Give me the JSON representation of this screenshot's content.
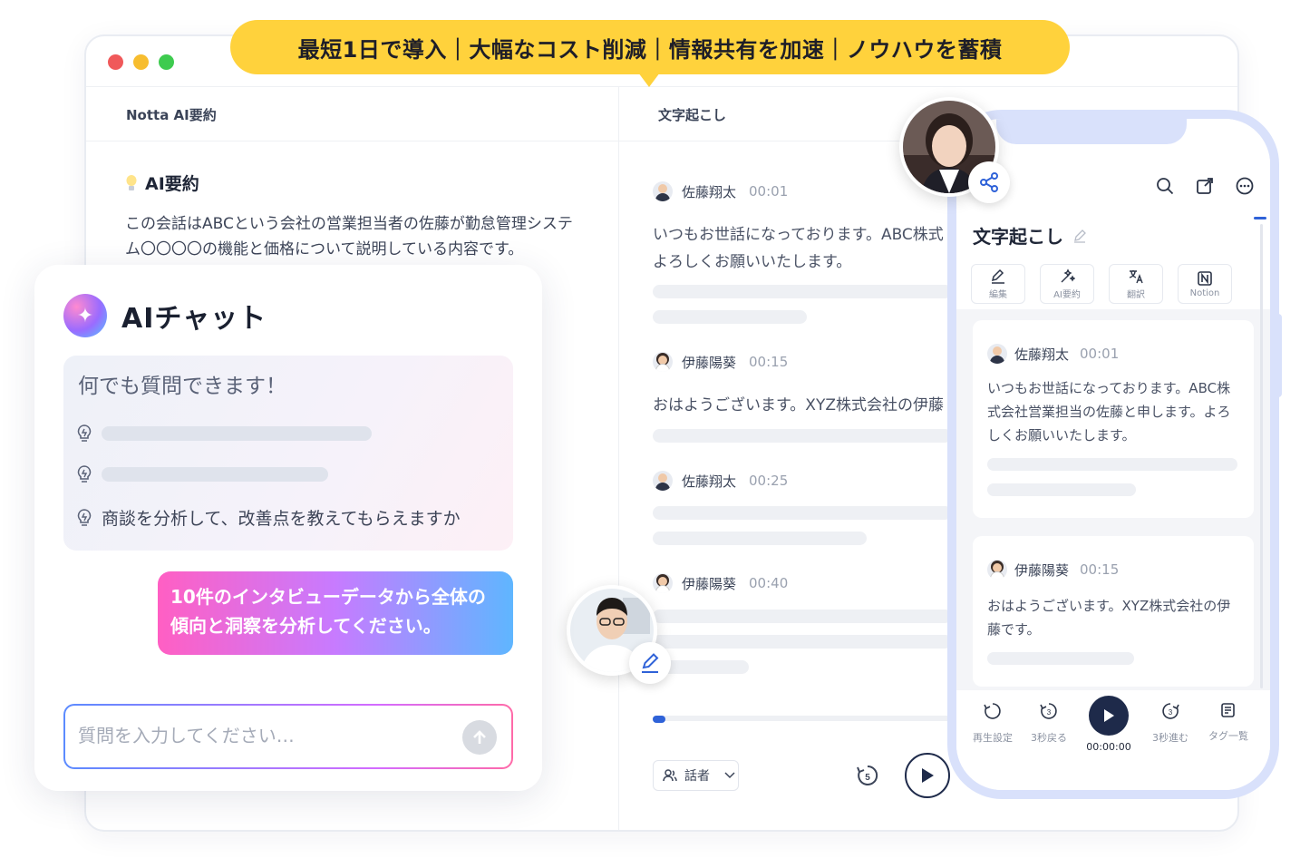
{
  "banner": {
    "text": "最短1日で導入｜大幅なコスト削減｜情報共有を加速｜ノウハウを蓄積"
  },
  "window": {
    "dot_colors": [
      "#f0595a",
      "#f7bd2f",
      "#3ecb4f"
    ],
    "left_panel_title": "Notta AI要約",
    "right_panel_title": "文字起こし"
  },
  "summary": {
    "title": "AI要約",
    "text": "この会話はABCという会社の営業担当者の佐藤が勤怠管理システム〇〇〇〇の機能と価格について説明している内容です。"
  },
  "chat": {
    "title": "AIチャット",
    "suggest_head": "何でも質問できます！",
    "suggestion_3": "商談を分析して、改善点を教えてもらえますか",
    "user_message": "10件のインタビューデータから全体の傾向と洞察を分析してください。",
    "input_placeholder": "質問を入力してください…"
  },
  "transcript": {
    "entries": [
      {
        "speaker": "佐藤翔太",
        "time": "00:01",
        "text1": "いつもお世話になっております。ABC株式",
        "text2": "よろしくお願いいたします。"
      },
      {
        "speaker": "伊藤陽葵",
        "time": "00:15",
        "text1": "おはようございます。XYZ株式会社の伊藤"
      },
      {
        "speaker": "佐藤翔太",
        "time": "00:25"
      },
      {
        "speaker": "伊藤陽葵",
        "time": "00:40"
      }
    ],
    "speaker_filter": "話者",
    "rewind_seconds": "5"
  },
  "phone": {
    "title": "文字起こし",
    "tools": [
      {
        "icon": "edit-icon",
        "label": "編集"
      },
      {
        "icon": "ai-sparkle-icon",
        "label": "AI要約"
      },
      {
        "icon": "translate-icon",
        "label": "翻訳"
      },
      {
        "icon": "notion-icon",
        "label": "Notion"
      }
    ],
    "card1": {
      "speaker": "佐藤翔太",
      "time": "00:01",
      "text": "いつもお世話になっております。ABC株式会社営業担当の佐藤と申します。よろしくお願いいたします。"
    },
    "card2": {
      "speaker": "伊藤陽葵",
      "time": "00:15",
      "text": "おはようございます。XYZ株式会社の伊藤です。"
    },
    "controls": {
      "speed": "再生設定",
      "back": "3秒戻る",
      "time": "00:00:00",
      "forward": "3秒進む",
      "tags": "タグ一覧",
      "back_num": "3",
      "forward_num": "3"
    }
  },
  "colors": {
    "accent": "#2f62d8",
    "banner": "#ffd23c",
    "dark": "#1e2a4a"
  }
}
